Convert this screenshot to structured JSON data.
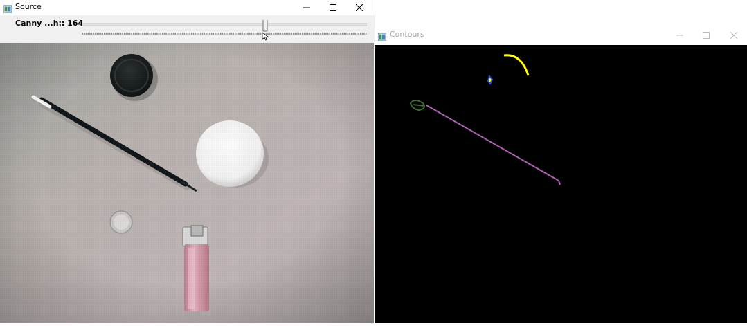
{
  "source_window": {
    "title": "Source",
    "icon": "opencv-window-icon",
    "controls": [
      "minimize-icon",
      "maximize-icon",
      "close-icon"
    ],
    "trackbar": {
      "label": "Canny ...h:: 164",
      "value": 164,
      "max": 255
    }
  },
  "contours_window": {
    "title": "Contours",
    "icon": "opencv-window-icon",
    "controls": [
      "minimize-icon",
      "maximize-icon",
      "close-icon"
    ],
    "contour_colors": [
      "#ffff00",
      "#2b4fd6",
      "#b060b6",
      "#3c6b2c"
    ]
  }
}
